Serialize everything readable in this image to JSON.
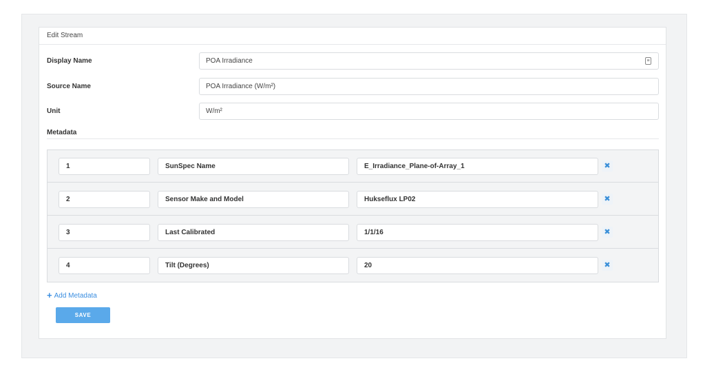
{
  "panel": {
    "title": "Edit Stream"
  },
  "fields": {
    "display_name": {
      "label": "Display Name",
      "value": "POA Irradiance",
      "icon": "id-card-icon"
    },
    "source_name": {
      "label": "Source Name",
      "value": "POA Irradiance (W/m²)"
    },
    "unit": {
      "label": "Unit",
      "value": "W/m²"
    }
  },
  "metadata": {
    "label": "Metadata",
    "rows": [
      {
        "index": "1",
        "key": "SunSpec Name",
        "value": "E_Irradiance_Plane-of-Array_1",
        "remove": "✖"
      },
      {
        "index": "2",
        "key": "Sensor Make and Model",
        "value": "Hukseflux LP02",
        "remove": "✖"
      },
      {
        "index": "3",
        "key": "Last Calibrated",
        "value": "1/1/16",
        "remove": "✖"
      },
      {
        "index": "4",
        "key": "Tilt (Degrees)",
        "value": "20",
        "remove": "✖"
      }
    ]
  },
  "actions": {
    "add_metadata": "Add Metadata",
    "add_icon": "+",
    "save": "SAVE"
  },
  "colors": {
    "accent": "#5aa9ea",
    "link": "#3b8ee0",
    "remove": "#3a8fd8"
  }
}
